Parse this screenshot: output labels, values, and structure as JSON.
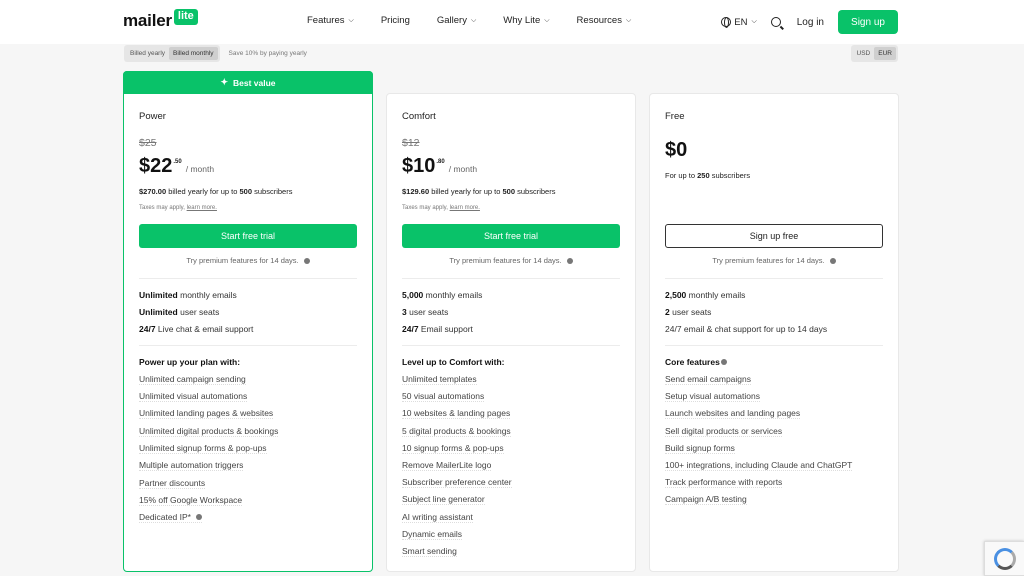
{
  "nav": {
    "logo_a": "mailer",
    "logo_b": "lite",
    "menu": [
      {
        "label": "Features",
        "has_dropdown": true
      },
      {
        "label": "Pricing",
        "has_dropdown": false
      },
      {
        "label": "Gallery",
        "has_dropdown": true
      },
      {
        "label": "Why Lite",
        "has_dropdown": true
      },
      {
        "label": "Resources",
        "has_dropdown": true
      }
    ],
    "language": "EN",
    "login": "Log in",
    "signup": "Sign up",
    "accent_color": "#09c269"
  },
  "billing": {
    "yearly": "Billed yearly",
    "monthly": "Billed monthly",
    "selected": "Billed monthly",
    "save_note": "Save 10% by paying yearly"
  },
  "currency": {
    "usd": "USD",
    "eur": "EUR",
    "selected": "EUR"
  },
  "plans": [
    {
      "badge": "Best value",
      "name": "Power",
      "old_price": "$25",
      "price": "$22",
      "cents": ".50",
      "per": "/ month",
      "billed_amount": "$270.00",
      "billed_text": "billed yearly for up to",
      "billed_subs": "500",
      "billed_tail": "subscribers",
      "taxes": "Taxes may apply,",
      "learn_more": "learn more.",
      "cta": "Start free trial",
      "try": "Try premium features for 14 days.",
      "core": [
        {
          "strong": "Unlimited",
          "text": "monthly emails"
        },
        {
          "strong": "Unlimited",
          "text": "user seats"
        },
        {
          "strong": "24/7",
          "text": "Live chat & email support"
        }
      ],
      "section_title": "Power up your plan with:",
      "items": [
        "Unlimited campaign sending",
        "Unlimited visual automations",
        "Unlimited landing pages & websites",
        "Unlimited digital products & bookings",
        "Unlimited signup forms & pop-ups",
        "Multiple automation triggers",
        "Partner discounts",
        "15% off Google Workspace",
        "Dedicated IP*"
      ]
    },
    {
      "name": "Comfort",
      "old_price": "$12",
      "price": "$10",
      "cents": ".80",
      "per": "/ month",
      "billed_amount": "$129.60",
      "billed_text": "billed yearly for up to",
      "billed_subs": "500",
      "billed_tail": "subscribers",
      "taxes": "Taxes may apply,",
      "learn_more": "learn more.",
      "cta": "Start free trial",
      "try": "Try premium features for 14 days.",
      "core": [
        {
          "strong": "5,000",
          "text": "monthly emails"
        },
        {
          "strong": "3",
          "text": "user seats"
        },
        {
          "strong": "24/7",
          "text": "Email support"
        }
      ],
      "section_title": "Level up to Comfort with:",
      "items": [
        "Unlimited templates",
        "50 visual automations",
        "10 websites & landing pages",
        "5 digital products & bookings",
        "10 signup forms & pop-ups",
        "Remove MailerLite logo",
        "Subscriber preference center",
        "Subject line generator",
        "AI writing assistant",
        "Dynamic emails",
        "Smart sending"
      ]
    },
    {
      "name": "Free",
      "price": "$0",
      "subs_prefix": "For up to",
      "subs": "250",
      "subs_tail": "subscribers",
      "cta": "Sign up free",
      "try": "Try premium features for 14 days.",
      "core": [
        {
          "strong": "2,500",
          "text": "monthly emails"
        },
        {
          "strong": "2",
          "text": "user seats"
        },
        {
          "strong": "",
          "text": "24/7 email & chat support for up to 14 days"
        }
      ],
      "section_title": "Core features",
      "items": [
        "Send email campaigns",
        "Setup visual automations",
        "Launch websites and landing pages",
        "Sell digital products or services",
        "Build signup forms",
        "100+ integrations, including Claude and ChatGPT",
        "Track performance with reports",
        "Campaign A/B testing"
      ]
    }
  ]
}
